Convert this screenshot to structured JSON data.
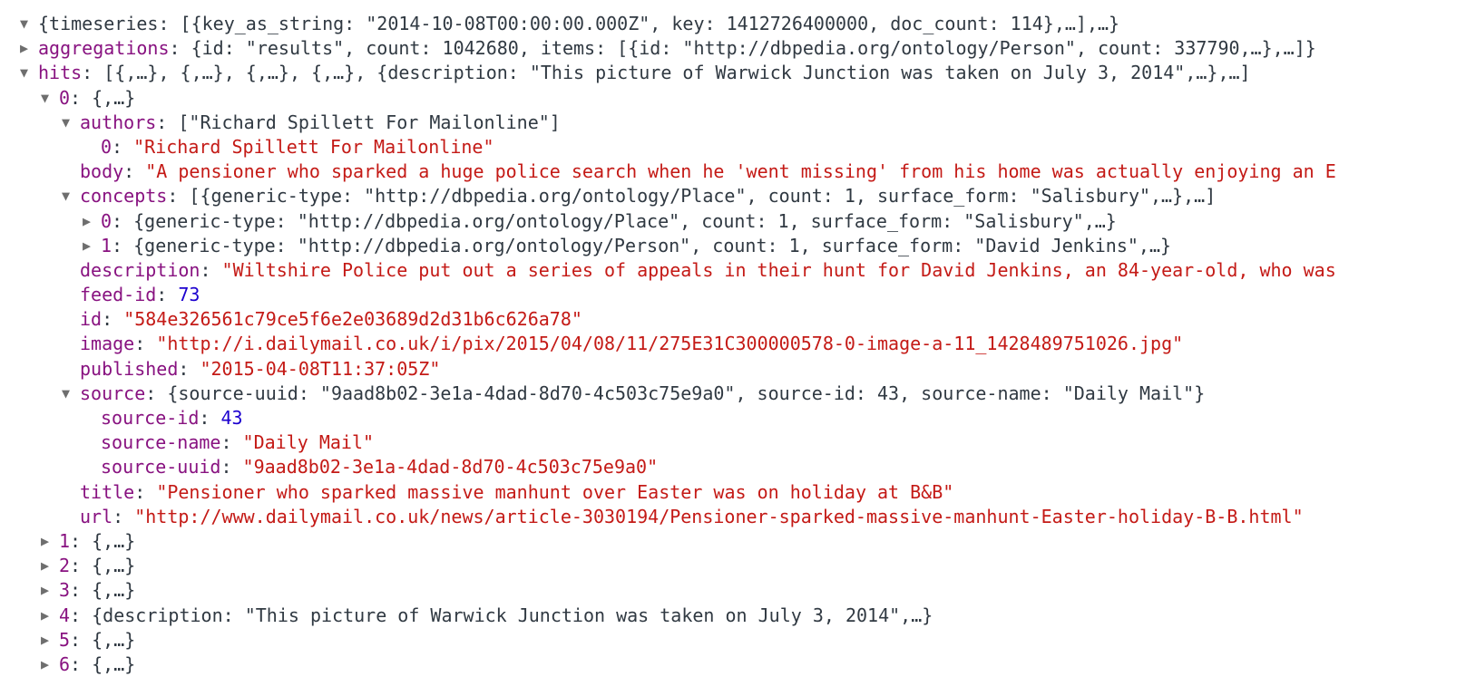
{
  "theme": {
    "key_color": "#881280",
    "string_color": "#c41a16",
    "number_color": "#1c00cf",
    "text_color": "#303942",
    "arrow_color": "#6e6e6e"
  },
  "icons": {
    "expanded": "▼",
    "collapsed": "▶",
    "expanded_name": "disclosure-expanded-icon",
    "collapsed_name": "disclosure-collapsed-icon"
  },
  "rows": [
    {
      "indent": 0,
      "toggle": "expanded",
      "parts": [
        {
          "t": "p",
          "v": "{timeseries: [{key_as_string: \"2014-10-08T00:00:00.000Z\", key: 1412726400000, doc_count: 114},…],…}"
        }
      ]
    },
    {
      "indent": 0,
      "toggle": "collapsed",
      "parts": [
        {
          "t": "k",
          "v": "aggregations"
        },
        {
          "t": "p",
          "v": ": {id: \"results\", count: 1042680, items: [{id: \"http://dbpedia.org/ontology/Person\", count: 337790,…},…]}"
        }
      ]
    },
    {
      "indent": 0,
      "toggle": "expanded",
      "parts": [
        {
          "t": "k",
          "v": "hits"
        },
        {
          "t": "p",
          "v": ": [{,…}, {,…}, {,…}, {,…}, {description: \"This picture of Warwick Junction was taken on July 3, 2014\",…},…]"
        }
      ]
    },
    {
      "indent": 1,
      "toggle": "expanded",
      "parts": [
        {
          "t": "k",
          "v": "0"
        },
        {
          "t": "p",
          "v": ": {,…}"
        }
      ]
    },
    {
      "indent": 2,
      "toggle": "expanded",
      "parts": [
        {
          "t": "k",
          "v": "authors"
        },
        {
          "t": "p",
          "v": ": [\"Richard Spillett For Mailonline\"]"
        }
      ]
    },
    {
      "indent": 3,
      "toggle": "",
      "parts": [
        {
          "t": "k",
          "v": "0"
        },
        {
          "t": "p",
          "v": ": "
        },
        {
          "t": "s",
          "v": "\"Richard Spillett For Mailonline\""
        }
      ]
    },
    {
      "indent": 2,
      "toggle": "",
      "parts": [
        {
          "t": "k",
          "v": "body"
        },
        {
          "t": "p",
          "v": ": "
        },
        {
          "t": "s",
          "v": "\"A pensioner who sparked a huge police search when he 'went missing' from his home was actually enjoying an E"
        }
      ]
    },
    {
      "indent": 2,
      "toggle": "expanded",
      "parts": [
        {
          "t": "k",
          "v": "concepts"
        },
        {
          "t": "p",
          "v": ": [{generic-type: \"http://dbpedia.org/ontology/Place\", count: 1, surface_form: \"Salisbury\",…},…]"
        }
      ]
    },
    {
      "indent": 3,
      "toggle": "collapsed",
      "parts": [
        {
          "t": "k",
          "v": "0"
        },
        {
          "t": "p",
          "v": ": {generic-type: \"http://dbpedia.org/ontology/Place\", count: 1, surface_form: \"Salisbury\",…}"
        }
      ]
    },
    {
      "indent": 3,
      "toggle": "collapsed",
      "parts": [
        {
          "t": "k",
          "v": "1"
        },
        {
          "t": "p",
          "v": ": {generic-type: \"http://dbpedia.org/ontology/Person\", count: 1, surface_form: \"David Jenkins\",…}"
        }
      ]
    },
    {
      "indent": 2,
      "toggle": "",
      "parts": [
        {
          "t": "k",
          "v": "description"
        },
        {
          "t": "p",
          "v": ": "
        },
        {
          "t": "s",
          "v": "\"Wiltshire Police put out a series of appeals in their hunt for David Jenkins, an 84-year-old, who was"
        }
      ]
    },
    {
      "indent": 2,
      "toggle": "",
      "parts": [
        {
          "t": "k",
          "v": "feed-id"
        },
        {
          "t": "p",
          "v": ": "
        },
        {
          "t": "n",
          "v": "73"
        }
      ]
    },
    {
      "indent": 2,
      "toggle": "",
      "parts": [
        {
          "t": "k",
          "v": "id"
        },
        {
          "t": "p",
          "v": ": "
        },
        {
          "t": "s",
          "v": "\"584e326561c79ce5f6e2e03689d2d31b6c626a78\""
        }
      ]
    },
    {
      "indent": 2,
      "toggle": "",
      "parts": [
        {
          "t": "k",
          "v": "image"
        },
        {
          "t": "p",
          "v": ": "
        },
        {
          "t": "s",
          "v": "\"http://i.dailymail.co.uk/i/pix/2015/04/08/11/275E31C300000578-0-image-a-11_1428489751026.jpg\""
        }
      ]
    },
    {
      "indent": 2,
      "toggle": "",
      "parts": [
        {
          "t": "k",
          "v": "published"
        },
        {
          "t": "p",
          "v": ": "
        },
        {
          "t": "s",
          "v": "\"2015-04-08T11:37:05Z\""
        }
      ]
    },
    {
      "indent": 2,
      "toggle": "expanded",
      "parts": [
        {
          "t": "k",
          "v": "source"
        },
        {
          "t": "p",
          "v": ": {source-uuid: \"9aad8b02-3e1a-4dad-8d70-4c503c75e9a0\", source-id: 43, source-name: \"Daily Mail\"}"
        }
      ]
    },
    {
      "indent": 3,
      "toggle": "",
      "parts": [
        {
          "t": "k",
          "v": "source-id"
        },
        {
          "t": "p",
          "v": ": "
        },
        {
          "t": "n",
          "v": "43"
        }
      ]
    },
    {
      "indent": 3,
      "toggle": "",
      "parts": [
        {
          "t": "k",
          "v": "source-name"
        },
        {
          "t": "p",
          "v": ": "
        },
        {
          "t": "s",
          "v": "\"Daily Mail\""
        }
      ]
    },
    {
      "indent": 3,
      "toggle": "",
      "parts": [
        {
          "t": "k",
          "v": "source-uuid"
        },
        {
          "t": "p",
          "v": ": "
        },
        {
          "t": "s",
          "v": "\"9aad8b02-3e1a-4dad-8d70-4c503c75e9a0\""
        }
      ]
    },
    {
      "indent": 2,
      "toggle": "",
      "parts": [
        {
          "t": "k",
          "v": "title"
        },
        {
          "t": "p",
          "v": ": "
        },
        {
          "t": "s",
          "v": "\"Pensioner who sparked massive manhunt over Easter was on holiday at B&B\""
        }
      ]
    },
    {
      "indent": 2,
      "toggle": "",
      "parts": [
        {
          "t": "k",
          "v": "url"
        },
        {
          "t": "p",
          "v": ": "
        },
        {
          "t": "s",
          "v": "\"http://www.dailymail.co.uk/news/article-3030194/Pensioner-sparked-massive-manhunt-Easter-holiday-B-B.html\""
        }
      ]
    },
    {
      "indent": 1,
      "toggle": "collapsed",
      "parts": [
        {
          "t": "k",
          "v": "1"
        },
        {
          "t": "p",
          "v": ": {,…}"
        }
      ]
    },
    {
      "indent": 1,
      "toggle": "collapsed",
      "parts": [
        {
          "t": "k",
          "v": "2"
        },
        {
          "t": "p",
          "v": ": {,…}"
        }
      ]
    },
    {
      "indent": 1,
      "toggle": "collapsed",
      "parts": [
        {
          "t": "k",
          "v": "3"
        },
        {
          "t": "p",
          "v": ": {,…}"
        }
      ]
    },
    {
      "indent": 1,
      "toggle": "collapsed",
      "parts": [
        {
          "t": "k",
          "v": "4"
        },
        {
          "t": "p",
          "v": ": {description: \"This picture of Warwick Junction was taken on July 3, 2014\",…}"
        }
      ]
    },
    {
      "indent": 1,
      "toggle": "collapsed",
      "parts": [
        {
          "t": "k",
          "v": "5"
        },
        {
          "t": "p",
          "v": ": {,…}"
        }
      ]
    },
    {
      "indent": 1,
      "toggle": "collapsed",
      "parts": [
        {
          "t": "k",
          "v": "6"
        },
        {
          "t": "p",
          "v": ": {,…}"
        }
      ]
    }
  ]
}
